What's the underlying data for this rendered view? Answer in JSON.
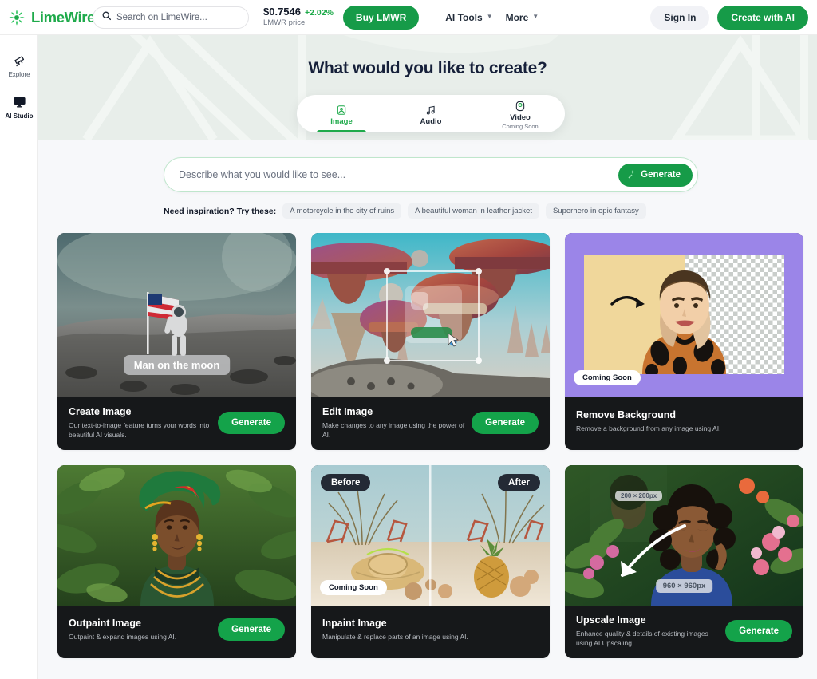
{
  "topbar": {
    "brand": "LimeWire",
    "search_placeholder": "Search on LimeWire...",
    "price_value": "$0.7546",
    "price_change": "+2.02%",
    "price_label": "LMWR price",
    "buy_label": "Buy LMWR",
    "nav": [
      {
        "label": "AI Tools"
      },
      {
        "label": "More"
      }
    ],
    "sign_in": "Sign In",
    "create_with_ai": "Create with AI"
  },
  "sidebar": {
    "items": [
      {
        "label": "Explore",
        "icon": "telescope-icon",
        "active": false
      },
      {
        "label": "AI Studio",
        "icon": "monitor-icon",
        "active": true
      }
    ]
  },
  "hero": {
    "title": "What would you like to create?"
  },
  "tabs": [
    {
      "label": "Image",
      "sub": "",
      "icon": "image-icon",
      "active": true
    },
    {
      "label": "Audio",
      "sub": "",
      "icon": "music-note-icon",
      "active": false
    },
    {
      "label": "Video",
      "sub": "Coming Soon",
      "icon": "video-circle-icon",
      "active": false
    }
  ],
  "prompt": {
    "placeholder": "Describe what you would like to see...",
    "value": "",
    "generate_label": "Generate"
  },
  "suggestions": {
    "label": "Need inspiration? Try these:",
    "chips": [
      "A motorcycle in the city of ruins",
      "A beautiful woman in leather jacket",
      "Superhero in epic fantasy"
    ]
  },
  "cards": [
    {
      "title": "Create Image",
      "desc": "Our text-to-image feature turns your words into beautiful AI visuals.",
      "button": "Generate",
      "overlay_caption": "Man on the moon"
    },
    {
      "title": "Edit Image",
      "desc": "Make changes to any image using the power of AI.",
      "button": "Generate"
    },
    {
      "title": "Remove Background",
      "desc": "Remove a background from any image using AI.",
      "badge": "Coming Soon"
    },
    {
      "title": "Outpaint Image",
      "desc": "Outpaint & expand images using AI.",
      "button": "Generate"
    },
    {
      "title": "Inpaint Image",
      "desc": "Manipulate & replace parts of an image using AI.",
      "badge": "Coming Soon",
      "badge_before": "Before",
      "badge_after": "After"
    },
    {
      "title": "Upscale Image",
      "desc": "Enhance quality & details of existing images using AI Upscaling.",
      "button": "Generate",
      "size_small": "200 × 200px",
      "size_large": "960 × 960px"
    }
  ],
  "colors": {
    "brand_green": "#1faa4b",
    "button_green": "#169b48",
    "card_dark": "#16181a",
    "hero_bg": "#e8eeea",
    "purple": "#9b85e8"
  }
}
